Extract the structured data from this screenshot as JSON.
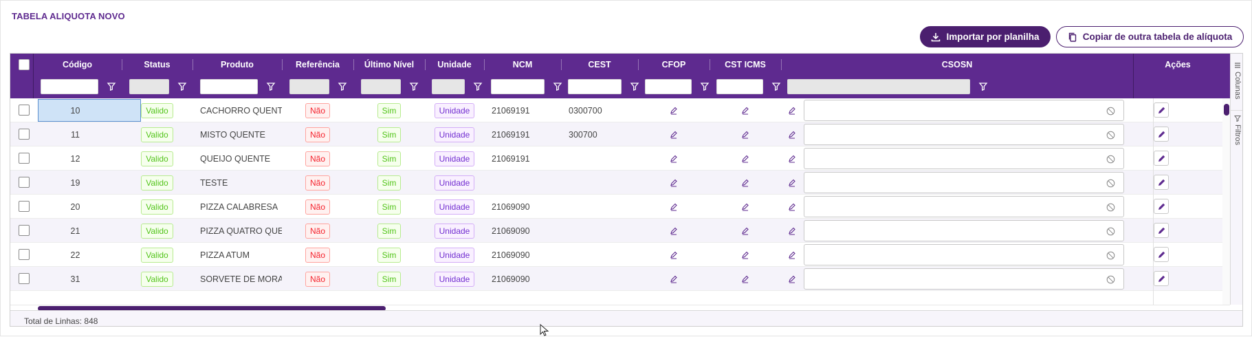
{
  "page": {
    "title": "TABELA ALIQUOTA NOVO"
  },
  "toolbar": {
    "import_label": "Importar por planilha",
    "copy_label": "Copiar de outra tabela de alíquota"
  },
  "columns": [
    "Código",
    "Status",
    "Produto",
    "Referência",
    "Último Nível",
    "Unidade",
    "NCM",
    "CEST",
    "CFOP",
    "CST ICMS",
    "CSOSN",
    "Ações"
  ],
  "side_panel": {
    "columns_label": "Colunas",
    "filters_label": "Filtros"
  },
  "rows": [
    {
      "codigo": "10",
      "status": "Valido",
      "produto": "CACHORRO QUENTE ...",
      "referencia": "Não",
      "ultimo_nivel": "Sim",
      "unidade": "Unidade",
      "ncm": "21069191",
      "cest": "0300700"
    },
    {
      "codigo": "11",
      "status": "Valido",
      "produto": "MISTO QUENTE",
      "referencia": "Não",
      "ultimo_nivel": "Sim",
      "unidade": "Unidade",
      "ncm": "21069191",
      "cest": "300700"
    },
    {
      "codigo": "12",
      "status": "Valido",
      "produto": "QUEIJO QUENTE",
      "referencia": "Não",
      "ultimo_nivel": "Sim",
      "unidade": "Unidade",
      "ncm": "21069191",
      "cest": ""
    },
    {
      "codigo": "19",
      "status": "Valido",
      "produto": "TESTE",
      "referencia": "Não",
      "ultimo_nivel": "Sim",
      "unidade": "Unidade",
      "ncm": "",
      "cest": ""
    },
    {
      "codigo": "20",
      "status": "Valido",
      "produto": "PIZZA CALABRESA",
      "referencia": "Não",
      "ultimo_nivel": "Sim",
      "unidade": "Unidade",
      "ncm": "21069090",
      "cest": ""
    },
    {
      "codigo": "21",
      "status": "Valido",
      "produto": "PIZZA QUATRO QUEIJ...",
      "referencia": "Não",
      "ultimo_nivel": "Sim",
      "unidade": "Unidade",
      "ncm": "21069090",
      "cest": ""
    },
    {
      "codigo": "22",
      "status": "Valido",
      "produto": "PIZZA ATUM",
      "referencia": "Não",
      "ultimo_nivel": "Sim",
      "unidade": "Unidade",
      "ncm": "21069090",
      "cest": ""
    },
    {
      "codigo": "31",
      "status": "Valido",
      "produto": "SORVETE DE MORAN...",
      "referencia": "Não",
      "ultimo_nivel": "Sim",
      "unidade": "Unidade",
      "ncm": "21069090",
      "cest": ""
    }
  ],
  "footer": {
    "total_label": "Total de Linhas: 848"
  },
  "colors": {
    "brand": "#5e2a8f",
    "brand_dark": "#4b1f6f",
    "green": "#52c41a",
    "red": "#f5222d",
    "purple": "#722ed1"
  },
  "icons": [
    "download-icon",
    "copy-icon",
    "filter-icon",
    "pencil-icon",
    "clear-icon",
    "edit-icon",
    "columns-icon"
  ]
}
